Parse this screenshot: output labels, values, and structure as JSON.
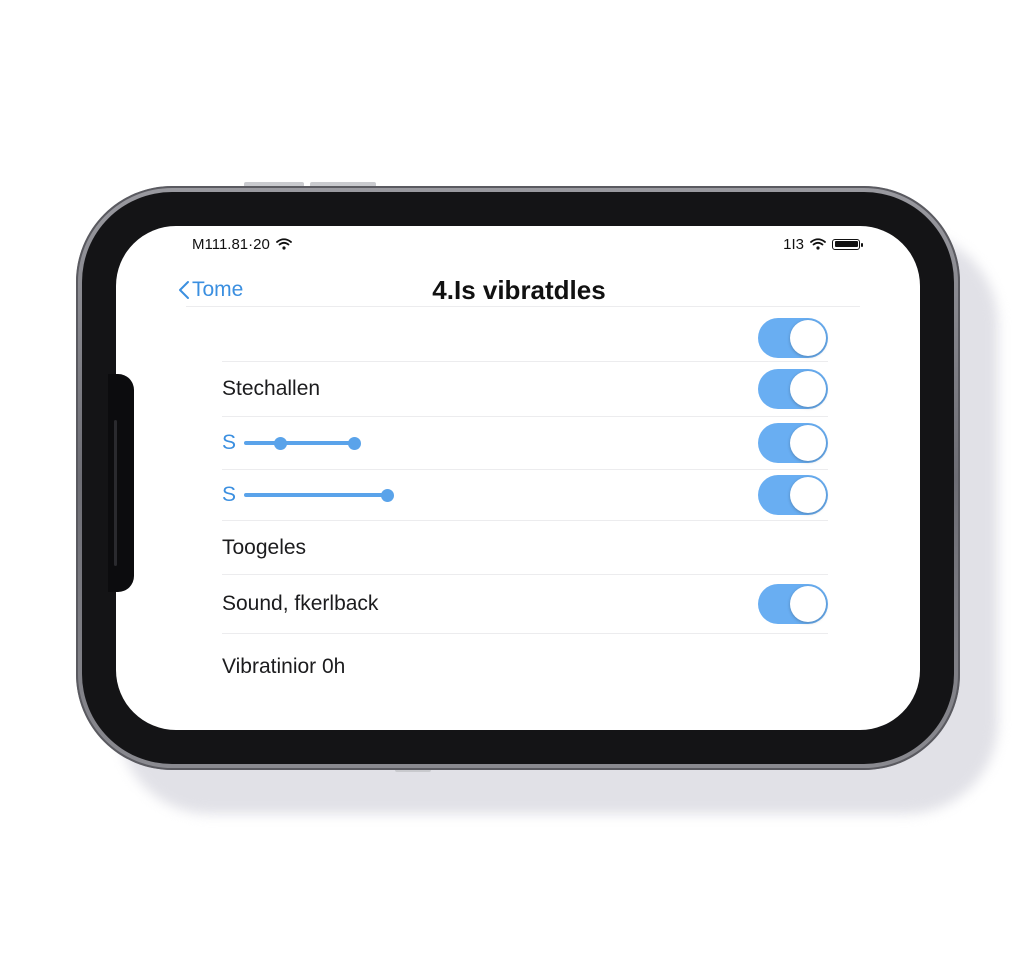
{
  "status_bar": {
    "time": "M111.81·20",
    "right_text": "1I3",
    "icons": [
      "wifi-icon",
      "battery-icon"
    ]
  },
  "nav": {
    "back_label": "Tome",
    "title": "4.Is vibratdles"
  },
  "rows": [
    {
      "id": "blank",
      "label": "",
      "toggle_on": true
    },
    {
      "id": "stechallen",
      "label": "Stechallen",
      "toggle_on": true
    },
    {
      "id": "slider1",
      "slider_label": "S",
      "toggle_on": true
    },
    {
      "id": "slider2",
      "slider_label": "S",
      "toggle_on": true
    },
    {
      "id": "toogeles",
      "label": "Toogeles"
    },
    {
      "id": "sound",
      "label": "Sound, fkerlback",
      "toggle_on": true
    },
    {
      "id": "vibration",
      "label": "Vibratinior 0h"
    }
  ],
  "colors": {
    "accent": "#3b8fe0",
    "toggle_on": "#69aef2",
    "slider": "#5aa3ea"
  }
}
